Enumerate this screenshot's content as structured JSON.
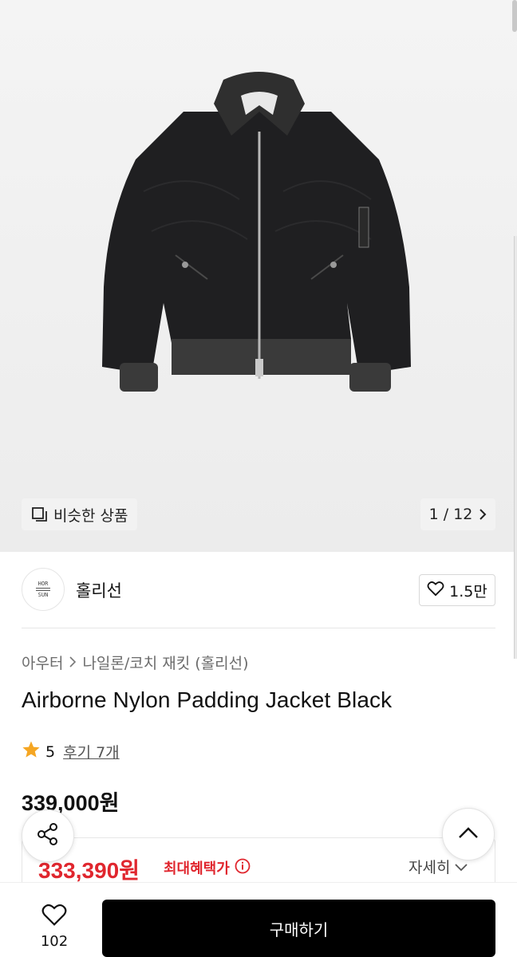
{
  "gallery": {
    "similar_label": "비슷한 상품",
    "counter": "1 / 12",
    "similar_icon": "copy-icon",
    "next_icon": "chevron-right-icon"
  },
  "brand": {
    "logo_lines": [
      "HOR",
      "SUN"
    ],
    "name": "홀리선",
    "like_count": "1.5만"
  },
  "breadcrumb": {
    "category": "아우터",
    "subcategory": "나일론/코치 재킷 (홀리선)"
  },
  "product": {
    "title": "Airborne Nylon Padding Jacket Black",
    "rating": "5",
    "reviews": "후기 7개",
    "price": "339,000원"
  },
  "benefit": {
    "price": "333,390원",
    "label": "최대혜택가",
    "detail": "자세히"
  },
  "bottom": {
    "wish_count": "102",
    "buy_label": "구매하기"
  },
  "colors": {
    "accent_red": "#e0262e",
    "star": "#f5a623",
    "buy_bg": "#000000"
  }
}
